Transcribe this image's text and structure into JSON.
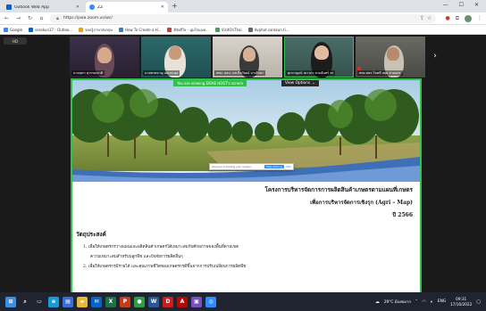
{
  "browser": {
    "tabs": [
      {
        "title": "Outlook Web App",
        "active": false,
        "favicon_color": "#0a64c8"
      },
      {
        "title": "ZZ",
        "active": true,
        "favicon_color": "#2d8cff"
      }
    ],
    "new_tab_icon": "plus-icon",
    "window_controls": [
      "minimize-icon",
      "maximize-icon",
      "close-icon"
    ],
    "url": "https://pwa.zoom.us/wc/",
    "bookmarks": [
      {
        "label": "Google",
        "color": "#4285f4"
      },
      {
        "label": "sarakun17 - Outloo...",
        "color": "#0a64c8"
      },
      {
        "label": "รอบรู้ภาษาอังกฤษ",
        "color": "#e0a020"
      },
      {
        "label": "How To Create a H...",
        "color": "#3a7bd5"
      },
      {
        "label": "ดีจังดีใจ - นุ่มใจนนท...",
        "color": "#d23a3a"
      },
      {
        "label": "VisitOnThai",
        "color": "#3aa757"
      },
      {
        "label": "dvphot.sarakun.ti...",
        "color": "#666"
      }
    ]
  },
  "zoom": {
    "top_badge": "HD",
    "participants": [
      {
        "name": "นายจุฑา สุวรรณชาติ"
      },
      {
        "name": "นายชายชาญ อ่อนละมุล"
      },
      {
        "name": "สพจ. สอน. นท.นีลวัณณ์ บางรักษา"
      },
      {
        "name": "ศุภกาญจน์ เยาวภา สวนจันทร์ รก"
      },
      {
        "name": "สพจ.สพร.โชคดี สบุย สายนทร"
      }
    ],
    "gallery_next_icon": "chevron-right-icon",
    "share_banner_text": "You are viewing DOAE HOST's screen",
    "view_options_label": "View Options",
    "slide": {
      "title_line1": "โครงการบริหารจัดการการผลิตสินค้าเกษตรตามแผนที่เกษตร",
      "title_line2": "เพื่อการบริหารจัดการเชิงรุก (Agri – Map)",
      "title_line3": "ปี 2566",
      "objective_heading": "วัตถุประสงค์",
      "objectives": [
        "1. เพื่อให้เกษตรกรวางแผนและผลิตสินค้าเกษตรได้เหมาะสมกับศักยภาพของพื้นที่ตามเขต",
        "ความเหมาะสมสำหรับปลูกพืช และปัจจัยการผลิตอื่นๆ",
        "2. เพื่อให้เกษตรกรมีรายได้ และคุณภาพชีวิตของเกษตรกรดีขึ้นจากการปรับเปลี่ยนการผลิตพืช"
      ],
      "tooltip_text": "zoom.us is sharing your screen.",
      "tooltip_stop": "Stop sharing",
      "tooltip_hide": "Hide"
    }
  },
  "taskbar": {
    "apps": [
      {
        "icon": "windows-start-icon",
        "color": "#3c8fe0",
        "glyph": "⊞"
      },
      {
        "icon": "search-icon",
        "color": "#1f2430",
        "glyph": "⌕"
      },
      {
        "icon": "task-view-icon",
        "color": "#1f2430",
        "glyph": "▭"
      },
      {
        "icon": "edge-icon",
        "color": "#1a9bd7",
        "glyph": "e"
      },
      {
        "icon": "store-icon",
        "color": "#3a6fd8",
        "glyph": "▤"
      },
      {
        "icon": "explorer-icon",
        "color": "#e8b838",
        "glyph": "▰"
      },
      {
        "icon": "mail-icon",
        "color": "#0a64c8",
        "glyph": "✉"
      },
      {
        "icon": "excel-icon",
        "color": "#1e7145",
        "glyph": "X"
      },
      {
        "icon": "powerpoint-icon",
        "color": "#c43e1c",
        "glyph": "P"
      },
      {
        "icon": "chrome-icon",
        "color": "#2f9e44",
        "glyph": "●"
      },
      {
        "icon": "word-icon",
        "color": "#2b579a",
        "glyph": "W"
      },
      {
        "icon": "app-red-icon",
        "color": "#c82020",
        "glyph": "D"
      },
      {
        "icon": "pdf-icon",
        "color": "#b30b00",
        "glyph": "A"
      },
      {
        "icon": "photos-icon",
        "color": "#7a4fbf",
        "glyph": "▣"
      },
      {
        "icon": "zoom-app-icon",
        "color": "#2d8cff",
        "glyph": "◎"
      }
    ],
    "weather": "29°C มีเมฆมาก",
    "language": "ENG",
    "time": "09:31",
    "date": "17/10/2022"
  }
}
